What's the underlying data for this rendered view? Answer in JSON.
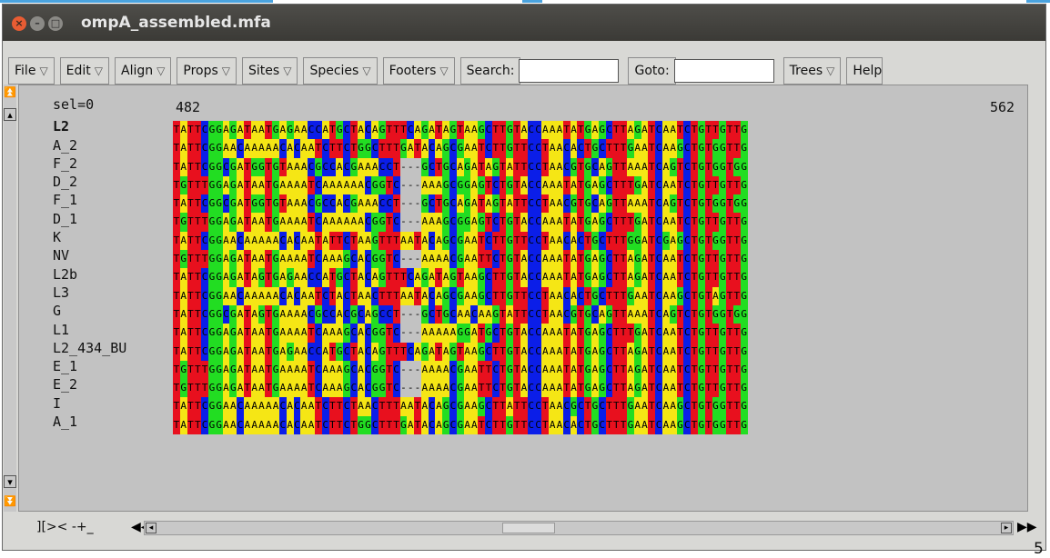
{
  "window": {
    "title": "ompA_assembled.mfa"
  },
  "menu": {
    "file": "File",
    "edit": "Edit",
    "align": "Align",
    "props": "Props",
    "sites": "Sites",
    "species": "Species",
    "footers": "Footers",
    "search": "Search:",
    "goto": "Goto:",
    "trees": "Trees",
    "help": "Help"
  },
  "search": {
    "value": ""
  },
  "goto": {
    "value": ""
  },
  "header": {
    "sel": "sel=0",
    "start_pos": "482",
    "end_pos": "562"
  },
  "bottom": {
    "mode": "][>< -+_"
  },
  "corner_label": "5",
  "colors": {
    "T": "#e8101e",
    "A": "#f5e615",
    "C": "#0b1ee8",
    "G": "#22dd22"
  },
  "sequences": [
    {
      "name": "L2",
      "bold": true,
      "seq": "TATTCGGAGATAATGAGAACCATGCTACAGTTTCAGATAGTAAGCTTGTACCAAATATGAGCTTAGATCAATCTGTTGTTG"
    },
    {
      "name": "A_2",
      "bold": false,
      "seq": "TATTCGGAACAAAAACACAATCTTCTGGCTTTGATACAGCGAATCTTGTTCCTAACACTGCTTTGAATCAAGCTGTGGTTG"
    },
    {
      "name": "F_2",
      "bold": false,
      "seq": "TATTCGGCGATGGTGTAAACGCCACGAAACCT---GCTGCAGATAGTATTCCTAACGTGCAGTTAAATCAGTCTGTGGTGG"
    },
    {
      "name": "D_2",
      "bold": false,
      "seq": "TGTTTGGAGATAATGAAAATCAAAAAACGGTC---AAAGCGGAGTCTGTACCAAATATGAGCTTTGATCAATCTGTTGTTG"
    },
    {
      "name": "F_1",
      "bold": false,
      "seq": "TATTCGGCGATGGTGTAAACGCCACGAAACCT---GCTGCAGATAGTATTCCTAACGTGCAGTTAAATCAGTCTGTGGTGG"
    },
    {
      "name": "D_1",
      "bold": false,
      "seq": "TGTTTGGAGATAATGAAAATCAAAAAACGGTC---AAAGCGGAGTCTGTACCAAATATGAGCTTTGATCAATCTGTTGTTG"
    },
    {
      "name": "K",
      "bold": false,
      "seq": "TATTCGGAACAAAAACACAATATTCTAAGTTTAATACAGCGAATCTTGTTCCTAACACTGCTTTGGATCGAGCTGTGGTTG"
    },
    {
      "name": "NV",
      "bold": false,
      "seq": "TGTTTGGAGATAATGAAAATCAAAGCACGGTC---AAAACGAATTCTGTACCAAATATGAGCTTAGATCAATCTGTTGTTG"
    },
    {
      "name": "L2b",
      "bold": false,
      "seq": "TATTCGGAGATAGTGAGAACCATGCTACAGTTTCAGATAGTAAGCTTGTACCAAATATGAGCTTAGATCAATCTGTTGTTG"
    },
    {
      "name": "L3",
      "bold": false,
      "seq": "TATTCGGAACAAAAACACAATCTACTAACTTTAATACAGCGAAGCTTGTTCCTAACACTGCTTTGAATCAAGCTGTAGTTG"
    },
    {
      "name": "G",
      "bold": false,
      "seq": "TATTCGGCGATAGTGAAAACGCCACGCAGCCT---GCTGCAACAAGTATTCCTAACGTGCAGTTAAATCAGTCTGTGGTGG"
    },
    {
      "name": "L1",
      "bold": false,
      "seq": "TATTCGGAGATAATGAAAATCAAAGCACGGTC---AAAAAGGATGCTGTACCAAATATGAGCTTTGATCAATCTGTTGTTG"
    },
    {
      "name": "L2_434_BU",
      "bold": false,
      "seq": "TATTCGGAGATAATGAGAACCATGCTACAGTTTCAGATAGTAAGCTTGTACCAAATATGAGCTTAGATCAATCTGTTGTTG"
    },
    {
      "name": "E_1",
      "bold": false,
      "seq": "TGTTTGGAGATAATGAAAATCAAAGCACGGTC---AAAACGAATTCTGTACCAAATATGAGCTTAGATCAATCTGTTGTTG"
    },
    {
      "name": "E_2",
      "bold": false,
      "seq": "TGTTTGGAGATAATGAAAATCAAAGCACGGTC---AAAACGAATTCTGTACCAAATATGAGCTTAGATCAATCTGTTGTTG"
    },
    {
      "name": "I",
      "bold": false,
      "seq": "TATTCGGAACAAAAACACAATCTTCTAACTTTAATACAGCGAAGCTTATTCCTAACGCTGCTTTGAATCAAGCTGTGGTTG"
    },
    {
      "name": "A_1",
      "bold": false,
      "seq": "TATTCGGAACAAAAACACAATCTTCTGGCTTTGATACAGCGAATCTTGTTCCTAACACTGCTTTGAATCAAGCTGTGGTTG"
    }
  ]
}
